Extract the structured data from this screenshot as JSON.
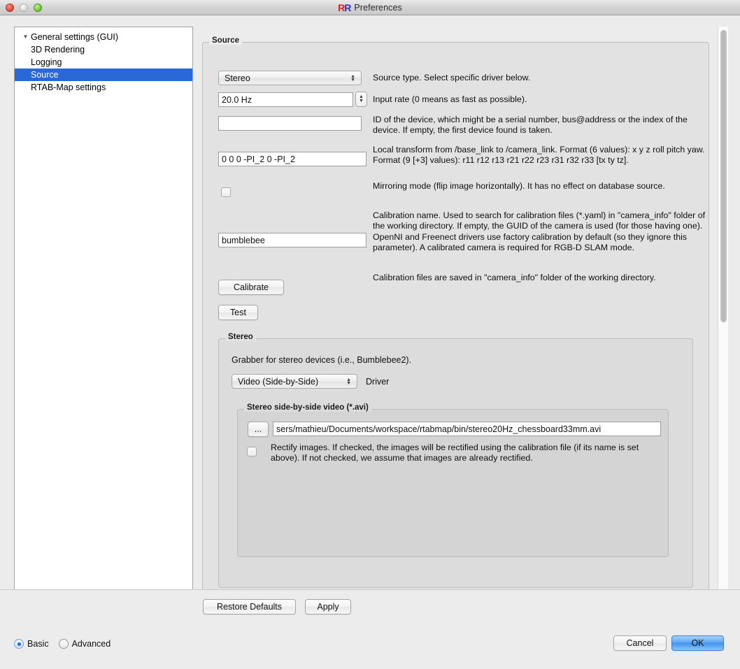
{
  "window": {
    "title": "Preferences",
    "logo_left": "R",
    "logo_right": ""
  },
  "tree": {
    "items": [
      {
        "label": "General settings (GUI)",
        "indent": 0,
        "twisty": "▼",
        "selected": false
      },
      {
        "label": "3D Rendering",
        "indent": 1,
        "twisty": "",
        "selected": false
      },
      {
        "label": "Logging",
        "indent": 1,
        "twisty": "",
        "selected": false
      },
      {
        "label": "Source",
        "indent": 0,
        "twisty": "",
        "selected": true
      },
      {
        "label": "RTAB-Map settings",
        "indent": 0,
        "twisty": "",
        "selected": false
      }
    ]
  },
  "source_group": {
    "title": "Source",
    "source_type": {
      "value": "Stereo",
      "description": "Source type. Select specific driver below."
    },
    "input_rate": {
      "value": "20.0 Hz",
      "description": "Input rate (0 means as fast as possible)."
    },
    "device_id": {
      "value": "",
      "description": "ID of the device, which might be a serial number, bus@address or the index of the device. If empty, the first device found is taken."
    },
    "local_transform": {
      "value": "0 0 0 -PI_2 0 -PI_2",
      "description": "Local transform from /base_link to /camera_link. Format (6 values): x y z roll pitch yaw. Format (9 [+3] values): r11 r12 r13 r21 r22 r23 r31 r32 r33 [tx ty tz]."
    },
    "mirroring": {
      "checked": false,
      "description": "Mirroring mode (flip image horizontally). It has no effect on database source."
    },
    "calibration_name": {
      "value": "bumblebee",
      "description": "Calibration name. Used to search for calibration files (*.yaml) in \"camera_info\" folder of the working directory. If empty, the GUID of the camera is used (for those having one). OpenNI and Freenect drivers use factory calibration by default (so they ignore this parameter). A calibrated camera is required for RGB-D SLAM mode."
    },
    "calibrate_button": {
      "label": "Calibrate",
      "description": "Calibration files are saved in \"camera_info\" folder of the working directory."
    },
    "test_button": {
      "label": "Test"
    }
  },
  "stereo_group": {
    "title": "Stereo",
    "grabber_note": "Grabber for stereo devices (i.e., Bumblebee2).",
    "driver": {
      "value": "Video (Side-by-Side)",
      "label": "Driver"
    },
    "video_group": {
      "title": "Stereo side-by-side video (*.avi)",
      "browse_button": "...",
      "path": "sers/mathieu/Documents/workspace/rtabmap/bin/stereo20Hz_chessboard33mm.avi",
      "rectify": {
        "checked": false,
        "description": "Rectify images. If checked, the images will be rectified using the calibration file (if its name is set above). If not checked, we assume that images are already rectified."
      }
    }
  },
  "footer": {
    "restore_defaults": "Restore Defaults",
    "apply": "Apply",
    "cancel": "Cancel",
    "ok": "OK",
    "mode_basic": "Basic",
    "mode_advanced": "Advanced",
    "mode_selected": "Basic"
  },
  "colors": {
    "selection_blue": "#2a68d8",
    "default_button_blue": "#3e93ee",
    "window_bg": "#ececec"
  }
}
